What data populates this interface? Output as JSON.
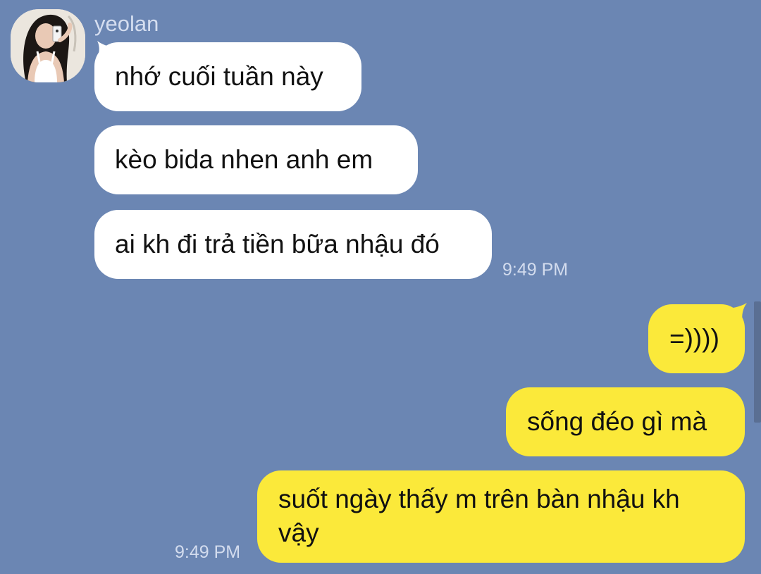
{
  "conversation": {
    "contact_name": "yeolan",
    "messages": [
      {
        "direction": "incoming",
        "text": "nhớ cuối tuần này"
      },
      {
        "direction": "incoming",
        "text": "kèo bida nhen anh em"
      },
      {
        "direction": "incoming",
        "text": "ai kh đi trả tiền bữa nhậu đó"
      },
      {
        "direction": "outgoing",
        "text": "=))))"
      },
      {
        "direction": "outgoing",
        "text": "sống đéo gì mà"
      },
      {
        "direction": "outgoing",
        "text": "suốt ngày thấy m trên bàn nhậu kh vậy"
      }
    ],
    "incoming_time": "9:49 PM",
    "outgoing_time": "9:49 PM"
  },
  "colors": {
    "background": "#6b86b3",
    "incoming_bubble": "#ffffff",
    "outgoing_bubble": "#fbe93a"
  },
  "icons": {
    "avatar": "contact-avatar-photo"
  }
}
